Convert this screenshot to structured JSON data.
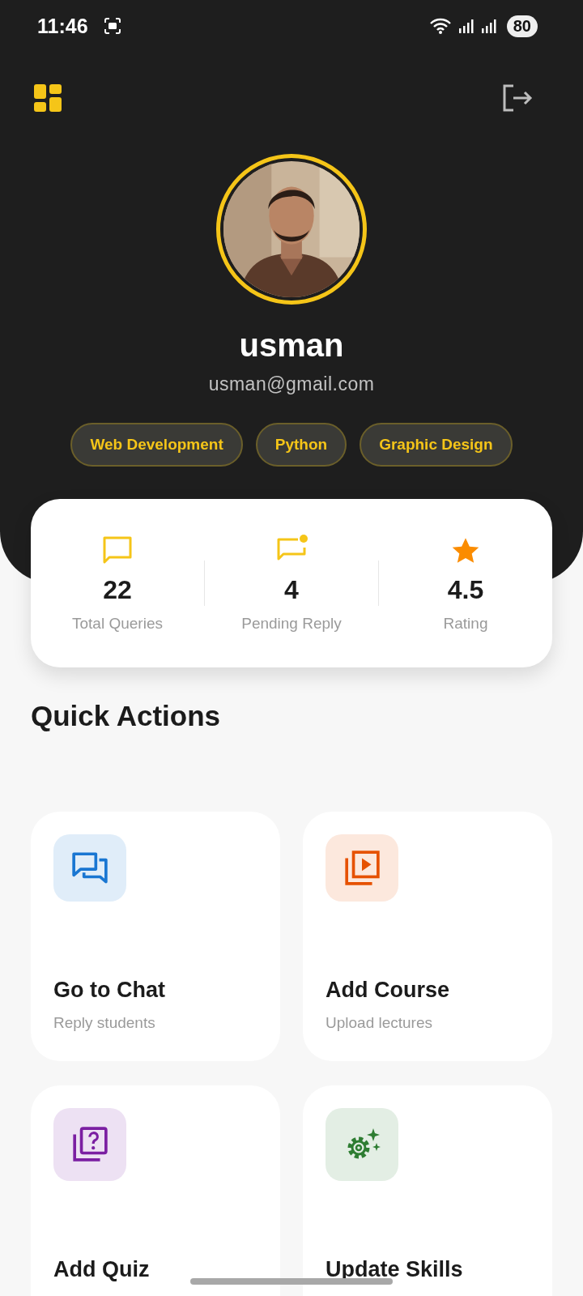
{
  "status_bar": {
    "time": "11:46",
    "battery": "80"
  },
  "profile": {
    "name": "usman",
    "email": "usman@gmail.com"
  },
  "skills": [
    "Web Development",
    "Python",
    "Graphic Design"
  ],
  "stats": [
    {
      "kind": "chat",
      "value": "22",
      "label": "Total Queries"
    },
    {
      "kind": "chat-dot",
      "value": "4",
      "label": "Pending Reply"
    },
    {
      "kind": "star",
      "value": "4.5",
      "label": "Rating"
    }
  ],
  "quick_actions": {
    "title": "Quick Actions",
    "items": [
      {
        "kind": "chat",
        "color": "#1976d2",
        "title": "Go to Chat",
        "subtitle": "Reply students"
      },
      {
        "kind": "video",
        "color": "#e65100",
        "title": "Add Course",
        "subtitle": "Upload lectures"
      },
      {
        "kind": "quiz",
        "color": "#7b1fa2",
        "title": "Add Quiz"
      },
      {
        "kind": "gear",
        "color": "#2e7d32",
        "title": "Update Skills"
      }
    ]
  }
}
